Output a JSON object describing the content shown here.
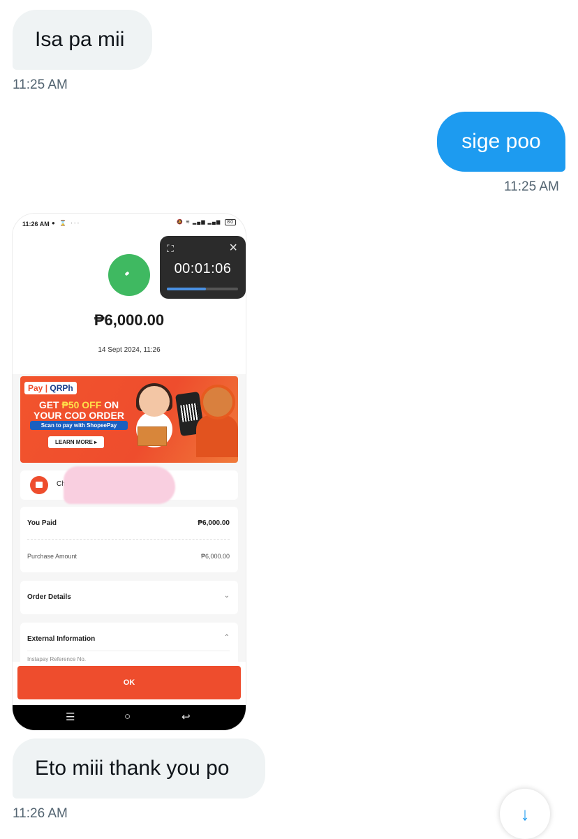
{
  "messages": [
    {
      "text": "Isa pa mii",
      "time": "11:25 AM",
      "direction": "incoming"
    },
    {
      "text": "sige poo",
      "time": "11:25 AM",
      "direction": "outgoing"
    },
    {
      "text": "Eto miii thank you po",
      "time": "11:26 AM",
      "direction": "incoming"
    }
  ],
  "screenshot": {
    "status_bar": {
      "time": "11:26 AM",
      "battery": "80"
    },
    "timer": {
      "value": "00:01:06",
      "progress": 0.55
    },
    "amount": "₱6,000.00",
    "date": "14 Sept 2024, 11:26",
    "banner": {
      "brand_pay": "Pay",
      "brand_qr": "QRPh",
      "headline_1": "GET ",
      "headline_highlight": "₱50 OFF",
      "headline_2": " ON YOUR COD ORDER",
      "subline": "Scan to pay with ShopeePay",
      "cta": "LEARN MORE ▸"
    },
    "merchant_initial": "Ch",
    "you_paid_label": "You Paid",
    "you_paid_value": "₱6,000.00",
    "purchase_label": "Purchase Amount",
    "purchase_value": "₱6,000.00",
    "order_details": "Order Details",
    "external_info": "External Information",
    "external_sub": "Instapay Reference No.",
    "ok_button": "OK",
    "nav": {
      "menu": "☰",
      "home": "○",
      "back": "↩"
    }
  },
  "colors": {
    "outgoing": "#1d9bf0",
    "incoming": "#eff3f4",
    "shopee": "#ee4d2d"
  },
  "scroll_down_icon": "↓"
}
